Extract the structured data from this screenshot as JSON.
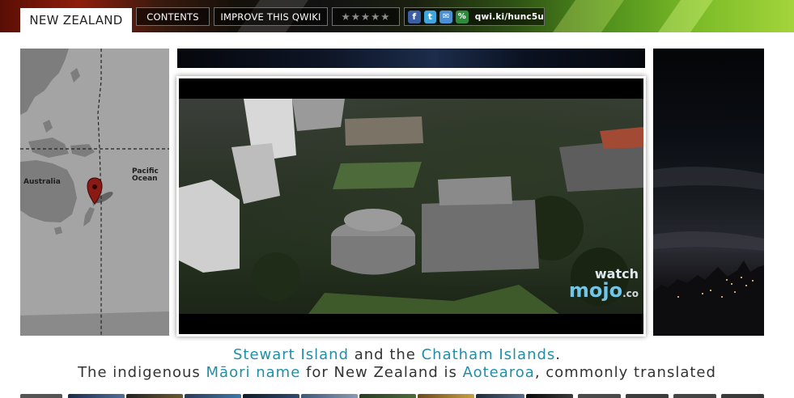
{
  "header": {
    "title": "NEW ZEALAND",
    "contents_label": "CONTENTS",
    "improve_label": "IMPROVE THIS QWIKI",
    "rating": {
      "stars": "★★★★★",
      "value": 0,
      "max": 5
    },
    "share": {
      "icons": [
        "facebook-icon",
        "twitter-icon",
        "email-icon",
        "qwiki-link-icon"
      ],
      "url": "qwi.ki/hunc5u"
    }
  },
  "map": {
    "labels": {
      "australia": "Australia",
      "pacific_ocean_line1": "Pacific",
      "pacific_ocean_line2": "Ocean"
    }
  },
  "video": {
    "watermark_line1": "watch",
    "watermark_line2": "mojo",
    "watermark_partial": ".co"
  },
  "caption": {
    "line1": {
      "link1": "Stewart Island",
      "text1": " and the ",
      "link2": "Chatham Islands",
      "text2": "."
    },
    "line2": {
      "text1": "The indigenous ",
      "link1": "Māori name",
      "text2": " for New Zealand is ",
      "link2": "Aotearoa",
      "text3": ", commonly translated"
    }
  },
  "colors": {
    "link": "#1f8fa8",
    "map_land": "#7d7d7d",
    "map_water": "#a4a4a4",
    "pin": "#8c1a14"
  }
}
